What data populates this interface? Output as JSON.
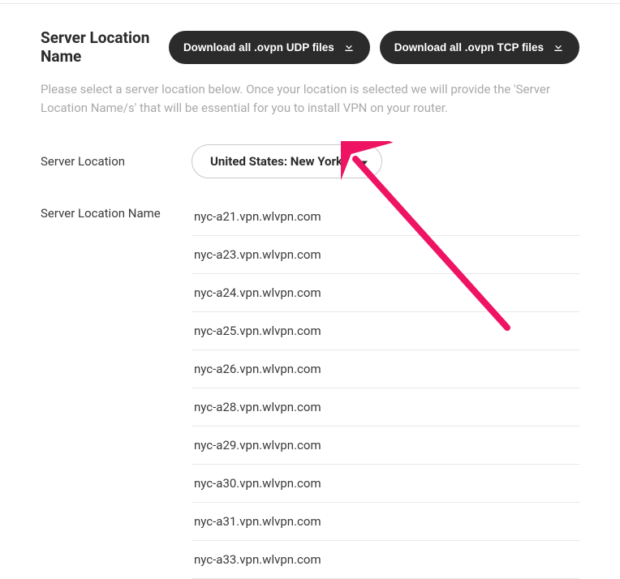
{
  "header": {
    "title": "Server Location Name",
    "download_udp": "Download all .ovpn UDP files",
    "download_tcp": "Download all .ovpn TCP files"
  },
  "description": "Please select a server location below. Once your location is selected we will provide the 'Server Location Name/s' that will be essential for you to install VPN on your router.",
  "labels": {
    "server_location": "Server Location",
    "server_location_name": "Server Location Name"
  },
  "location_select": {
    "value": "United States: New York"
  },
  "servers": [
    "nyc-a21.vpn.wlvpn.com",
    "nyc-a23.vpn.wlvpn.com",
    "nyc-a24.vpn.wlvpn.com",
    "nyc-a25.vpn.wlvpn.com",
    "nyc-a26.vpn.wlvpn.com",
    "nyc-a28.vpn.wlvpn.com",
    "nyc-a29.vpn.wlvpn.com",
    "nyc-a30.vpn.wlvpn.com",
    "nyc-a31.vpn.wlvpn.com",
    "nyc-a33.vpn.wlvpn.com"
  ]
}
